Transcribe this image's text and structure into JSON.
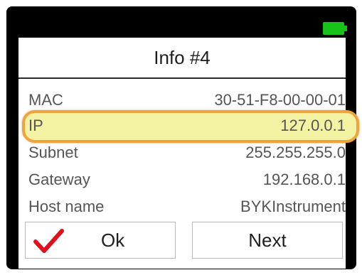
{
  "status": {
    "battery_icon": "battery-full-icon",
    "battery_color": "#19c219"
  },
  "screen": {
    "title": "Info #4"
  },
  "info": {
    "rows": [
      {
        "label": "MAC",
        "value": "30-51-F8-00-00-01"
      },
      {
        "label": "IP",
        "value": "127.0.0.1"
      },
      {
        "label": "Subnet",
        "value": "255.255.255.0"
      },
      {
        "label": "Gateway",
        "value": "192.168.0.1"
      },
      {
        "label": "Host name",
        "value": "BYKInstrument"
      }
    ],
    "highlight_color": "#f4f3a4",
    "highlight_border": "#f0a23c"
  },
  "buttons": {
    "ok_label": "Ok",
    "ok_icon": "checkmark-icon",
    "check_color": "#e0101e",
    "next_label": "Next"
  }
}
